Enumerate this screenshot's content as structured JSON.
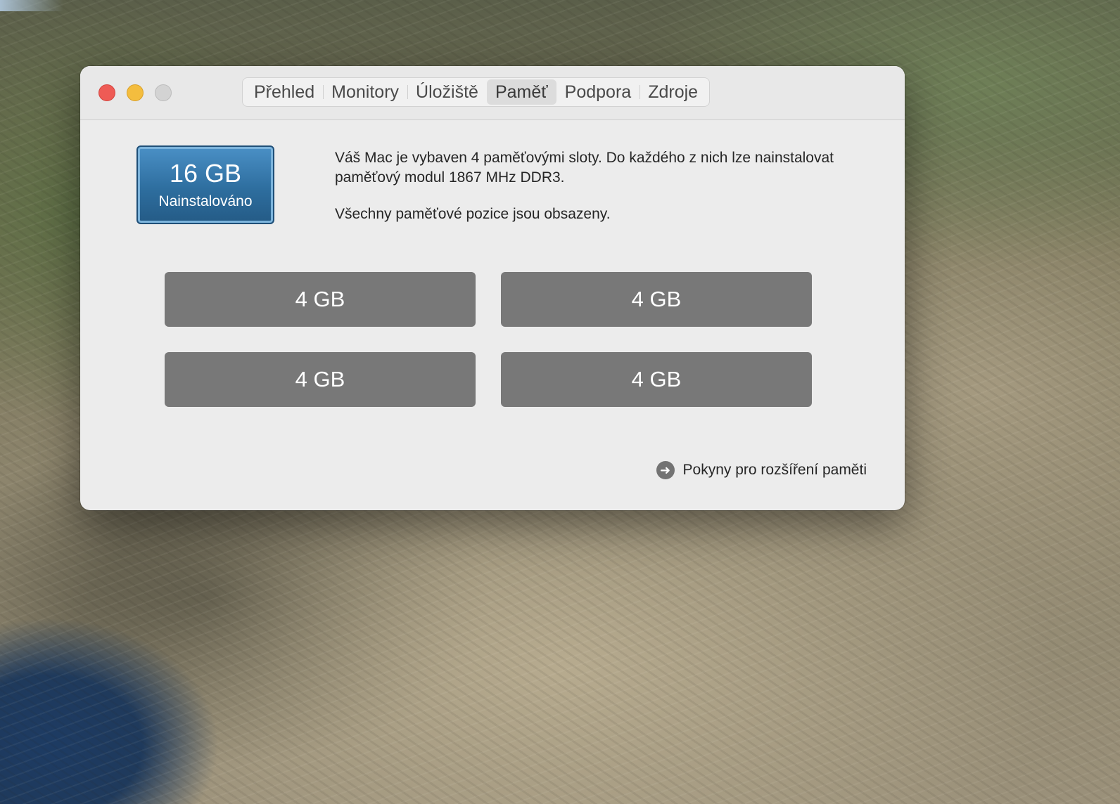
{
  "window": {
    "tabs": [
      {
        "label": "Přehled",
        "active": false
      },
      {
        "label": "Monitory",
        "active": false
      },
      {
        "label": "Úložiště",
        "active": false
      },
      {
        "label": "Paměť",
        "active": true
      },
      {
        "label": "Podpora",
        "active": false
      },
      {
        "label": "Zdroje",
        "active": false
      }
    ]
  },
  "memory": {
    "installed_size": "16 GB",
    "installed_label": "Nainstalováno",
    "description_line1": "Váš Mac je vybaven 4 paměťovými sloty. Do každého z nich lze nainstalovat paměťový modul 1867 MHz DDR3.",
    "description_line2": "Všechny paměťové pozice jsou obsazeny.",
    "slots": [
      "4 GB",
      "4 GB",
      "4 GB",
      "4 GB"
    ],
    "upgrade_link": "Pokyny pro rozšíření paměti"
  },
  "colors": {
    "close": "#ee5b55",
    "minimize": "#f4bd3e",
    "zoom": "#d3d3d3",
    "badge": "#2e6e9f",
    "slot": "#787878"
  },
  "icons": {
    "link": "arrow-right-circle-icon"
  }
}
